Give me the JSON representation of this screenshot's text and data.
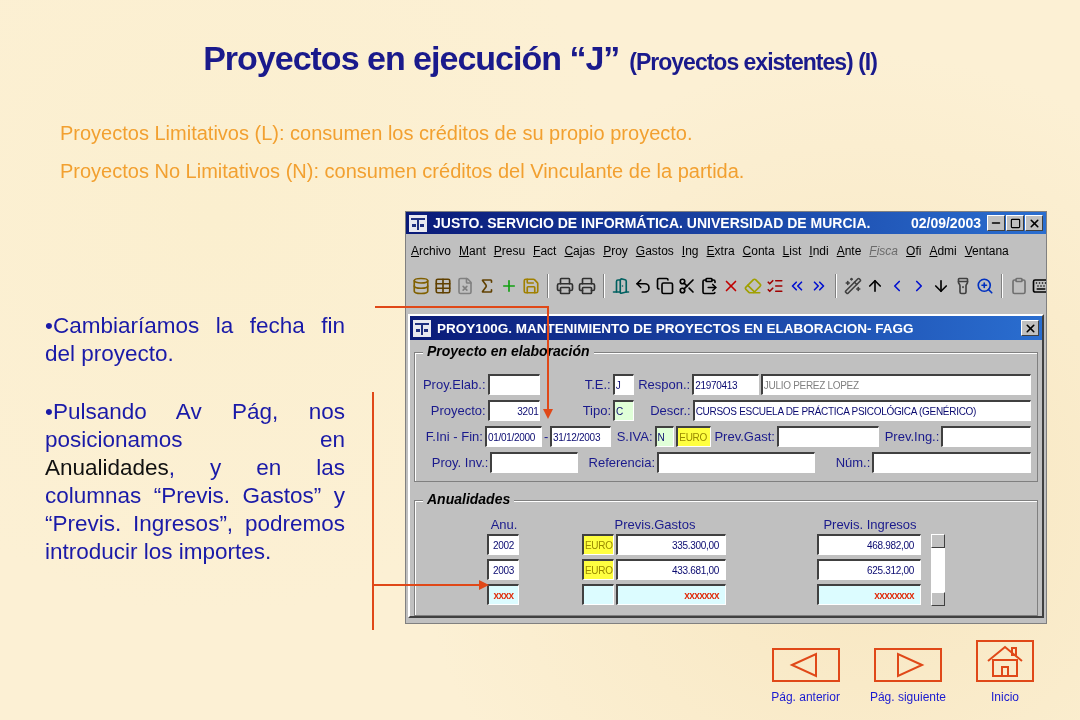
{
  "title": {
    "main": "Proyectos en ejecución “J”",
    "sub": "(Proyectos existentes) (I)"
  },
  "notes": [
    "Proyectos Limitativos (L): consumen los créditos de su propio proyecto.",
    "Proyectos No Limitativos (N): consumen créditos del Vinculante de la partida."
  ],
  "bullets": [
    [
      {
        "text": "•Cambiaríamos la fecha fin del proyecto.",
        "highlight": false
      }
    ],
    [
      {
        "text": "•Pulsando Av Pág, nos posicionamos en ",
        "highlight": false
      },
      {
        "text": "Anualidades",
        "highlight": true
      },
      {
        "text": ", y en las columnas “Previs. Gastos” y “Previs. Ingresos”, podremos introducir los importes.",
        "highlight": false
      }
    ]
  ],
  "app": {
    "title": "JUSTO. SERVICIO DE INFORMÁTICA. UNIVERSIDAD DE MURCIA.",
    "date": "02/09/2003",
    "menu": [
      {
        "label": "Archivo",
        "disabled": false
      },
      {
        "label": "Mant",
        "disabled": false
      },
      {
        "label": "Presu",
        "disabled": false
      },
      {
        "label": "Fact",
        "disabled": false
      },
      {
        "label": "Cajas",
        "disabled": false
      },
      {
        "label": "Proy",
        "disabled": false
      },
      {
        "label": "Gastos",
        "disabled": false
      },
      {
        "label": "Ing",
        "disabled": false
      },
      {
        "label": "Extra",
        "disabled": false
      },
      {
        "label": "Conta",
        "disabled": false
      },
      {
        "label": "List",
        "disabled": false
      },
      {
        "label": "Indi",
        "disabled": false
      },
      {
        "label": "Ante",
        "disabled": false
      },
      {
        "label": "Fisca",
        "disabled": true
      },
      {
        "label": "Ofi",
        "disabled": false
      },
      {
        "label": "Admi",
        "disabled": false
      },
      {
        "label": "Ventana",
        "disabled": false
      }
    ],
    "form": {
      "title": "PROY100G. MANTENIMIENTO DE PROYECTOS EN ELABORACION- FAGG",
      "group": "Proyecto en elaboración",
      "rows": [
        [
          {
            "label": "Proy.Elab.:",
            "inputs": [
              {
                "kind": "plain"
              }
            ]
          },
          {
            "label": "T.E.:",
            "inputs": [
              {
                "kind": "plain",
                "value": "J"
              }
            ]
          },
          {
            "label": "Respon.:",
            "inputs": [
              {
                "kind": "plain",
                "value": "21970413"
              },
              {
                "kind": "muted",
                "value": "JULIO PEREZ LOPEZ"
              }
            ]
          }
        ],
        [
          {
            "label": "Proyecto:",
            "inputs": [
              {
                "kind": "number",
                "value": "3201"
              }
            ]
          },
          {
            "label": "Tipo:",
            "inputs": [
              {
                "kind": "shaded",
                "value": "C"
              }
            ]
          },
          {
            "label": "Descr.:",
            "inputs": [
              {
                "kind": "plain",
                "value": "CURSOS ESCUELA DE PRÁCTICA PSICOLÓGICA (GENÉRICO)"
              }
            ]
          }
        ],
        [
          {
            "label": "F.Ini - Fin:",
            "inputs": [
              {
                "kind": "plain",
                "value": "01/01/2000"
              }
            ]
          },
          {
            "label": "-",
            "inputs": [
              {
                "kind": "plain",
                "value": "31/12/2003"
              }
            ]
          },
          {
            "label": "S.IVA:",
            "inputs": [
              {
                "kind": "shaded",
                "value": "N"
              },
              {
                "kind": "currency",
                "value": "EURO"
              }
            ]
          },
          {
            "label": "Prev.Gast:",
            "inputs": [
              {
                "kind": "plain"
              }
            ]
          },
          {
            "label": "Prev.Ing.:",
            "inputs": [
              {
                "kind": "plain"
              }
            ]
          }
        ],
        [
          {
            "label": "Proy. Inv.:",
            "inputs": [
              {
                "kind": "plain"
              }
            ]
          },
          {
            "label": "Referencia:",
            "inputs": [
              {
                "kind": "plain"
              }
            ]
          },
          {
            "label": "Núm.:",
            "inputs": [
              {
                "kind": "plain"
              }
            ]
          }
        ]
      ],
      "annual": {
        "title": "Anualidades",
        "columns": [
          "Anu.",
          "Previs.Gastos",
          "Previs. Ingresos"
        ],
        "rows": [
          {
            "kind": "saved",
            "year": "2002",
            "currency": "EURO",
            "gastos": "335.300,00",
            "ingresos": "468.982,00"
          },
          {
            "kind": "saved",
            "year": "2003",
            "currency": "EURO",
            "gastos": "433.681,00",
            "ingresos": "625.312,00"
          },
          {
            "kind": "new",
            "year": "xxxx",
            "gastos": "xxxxxxx",
            "ingresos": "xxxxxxxx"
          }
        ]
      }
    }
  },
  "nav": [
    {
      "kind": "prev",
      "label": "Pág. anterior"
    },
    {
      "kind": "next",
      "label": "Pág. siguiente"
    },
    {
      "kind": "home",
      "label": "Inicio"
    }
  ]
}
